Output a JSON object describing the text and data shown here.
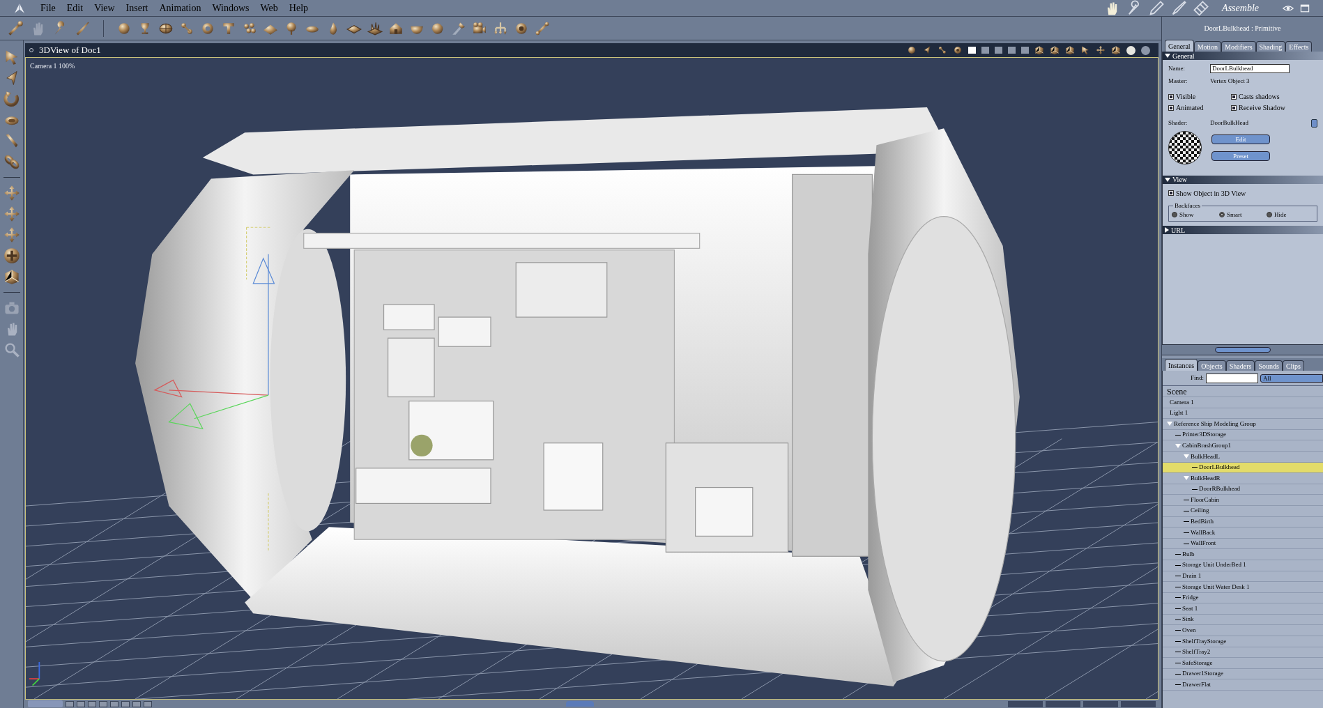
{
  "menu": [
    "File",
    "Edit",
    "View",
    "Insert",
    "Animation",
    "Windows",
    "Web",
    "Help"
  ],
  "room": {
    "label": "Assemble"
  },
  "viewport": {
    "title": "3DView of Doc1",
    "camera_label": "Camera 1 100%"
  },
  "properties": {
    "header": "DoorLBulkhead : Primitive",
    "tabs": [
      {
        "label": "General",
        "selected": true
      },
      {
        "label": "Motion",
        "selected": false
      },
      {
        "label": "Modifiers",
        "selected": false
      },
      {
        "label": "Shading",
        "selected": false
      },
      {
        "label": "Effects",
        "selected": false
      }
    ],
    "sections": [
      {
        "kind": "general",
        "title": "General",
        "expanded": true,
        "name_label": "Name:",
        "name_value": "DoorLBulkhead",
        "master_label": "Master:",
        "master_value": "Vertex Object 3",
        "checkboxes": [
          {
            "label": "Visible",
            "checked": true
          },
          {
            "label": "Casts shadows",
            "checked": true
          },
          {
            "label": "Animated",
            "checked": true
          },
          {
            "label": "Receive Shadow",
            "checked": true
          }
        ],
        "shader_label": "Shader:",
        "shader_value": "DoorBulkHead",
        "buttons": [
          "Edit",
          "Preset"
        ]
      },
      {
        "kind": "view",
        "title": "View",
        "expanded": true,
        "show_object": {
          "label": "Show Object in 3D View",
          "checked": true
        },
        "backfaces_label": "Backfaces",
        "radios": [
          {
            "label": "Show",
            "selected": false
          },
          {
            "label": "Smart",
            "selected": true
          },
          {
            "label": "Hide",
            "selected": false
          }
        ]
      },
      {
        "kind": "url",
        "title": "URL",
        "expanded": false
      }
    ]
  },
  "browser": {
    "tabs": [
      {
        "label": "Instances",
        "selected": true
      },
      {
        "label": "Objects",
        "selected": false
      },
      {
        "label": "Shaders",
        "selected": false
      },
      {
        "label": "Sounds",
        "selected": false
      },
      {
        "label": "Clips",
        "selected": false
      }
    ],
    "find_label": "Find:",
    "filter_value": "All",
    "root": "Scene",
    "tree": [
      {
        "label": "Camera 1",
        "selected": false
      },
      {
        "label": "Light 1",
        "selected": false
      },
      {
        "label": "Reference Ship Modeling Group",
        "selected": false,
        "expanded": true,
        "children": [
          {
            "label": "Printer3DStorage",
            "selected": false
          },
          {
            "label": "CabinBrashGroup1",
            "selected": false,
            "expanded": true,
            "children": [
              {
                "label": "BulkHeadL",
                "selected": false,
                "expanded": true,
                "children": [
                  {
                    "label": "DoorLBulkhead",
                    "selected": true
                  }
                ]
              },
              {
                "label": "BulkHeadR",
                "selected": false,
                "expanded": true,
                "children": [
                  {
                    "label": "DoorRBulkhead",
                    "selected": false
                  }
                ]
              },
              {
                "label": "FloorCabin",
                "selected": false
              },
              {
                "label": "Ceiling",
                "selected": false
              },
              {
                "label": "BedBirth",
                "selected": false
              },
              {
                "label": "WallBack",
                "selected": false
              },
              {
                "label": "WallFront",
                "selected": false
              }
            ]
          },
          {
            "label": "Bulb",
            "selected": false
          },
          {
            "label": "Storage Unit UnderBed 1",
            "selected": false
          },
          {
            "label": "Drain 1",
            "selected": false
          },
          {
            "label": "Storage Unit Water Desk 1",
            "selected": false
          },
          {
            "label": "Fridge",
            "selected": false
          },
          {
            "label": "Seat 1",
            "selected": false
          },
          {
            "label": "Sink",
            "selected": false
          },
          {
            "label": "Oven",
            "selected": false
          },
          {
            "label": "ShelfTrayStorage",
            "selected": false
          },
          {
            "label": "ShelfTray2",
            "selected": false
          },
          {
            "label": "SafeStorage",
            "selected": false
          },
          {
            "label": "Drawer1Storage",
            "selected": false
          },
          {
            "label": "DrawerFlat",
            "selected": false
          }
        ]
      }
    ]
  }
}
